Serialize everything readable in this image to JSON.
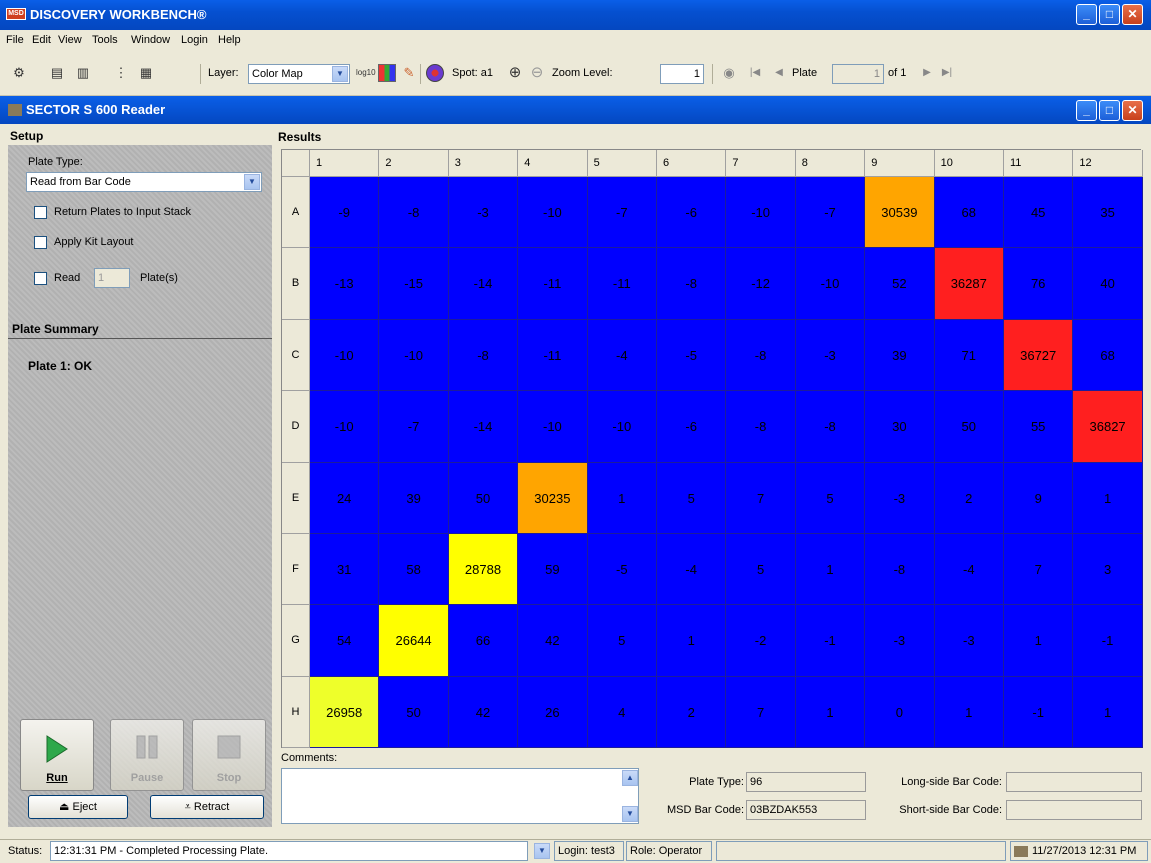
{
  "app": {
    "title": "DISCOVERY WORKBENCH®",
    "logo_text": "MSD"
  },
  "menu": [
    "File",
    "Edit",
    "View",
    "Tools",
    "Window",
    "Login",
    "Help"
  ],
  "toolbar": {
    "layer_label": "Layer:",
    "layer_value": "Color Map",
    "spot_label": "Spot: a1",
    "zoom_label": "Zoom Level:",
    "zoom_value": "1",
    "plate_label": "Plate",
    "plate_value": "1",
    "plate_of": "of 1",
    "log_label": "log10"
  },
  "inner_window": {
    "title": "SECTOR S 600 Reader"
  },
  "setup": {
    "header": "Setup",
    "plate_type_label": "Plate Type:",
    "plate_type_value": "Read from Bar Code",
    "return_plates": "Return Plates to Input Stack",
    "apply_kit": "Apply Kit Layout",
    "read_label": "Read",
    "read_value": "1",
    "plates_label": "Plate(s)",
    "summary_header": "Plate Summary",
    "summary_line": "Plate 1: OK",
    "run": "Run",
    "pause": "Pause",
    "stop": "Stop",
    "eject": "Eject",
    "retract": "Retract"
  },
  "results": {
    "header": "Results",
    "columns": [
      "1",
      "2",
      "3",
      "4",
      "5",
      "6",
      "7",
      "8",
      "9",
      "10",
      "11",
      "12"
    ],
    "rows": [
      {
        "label": "A",
        "values": [
          "-9",
          "-8",
          "-3",
          "-10",
          "-7",
          "-6",
          "-10",
          "-7",
          "30539",
          "68",
          "45",
          "35"
        ]
      },
      {
        "label": "B",
        "values": [
          "-13",
          "-15",
          "-14",
          "-11",
          "-11",
          "-8",
          "-12",
          "-10",
          "52",
          "36287",
          "76",
          "40"
        ]
      },
      {
        "label": "C",
        "values": [
          "-10",
          "-10",
          "-8",
          "-11",
          "-4",
          "-5",
          "-8",
          "-3",
          "39",
          "71",
          "36727",
          "68"
        ]
      },
      {
        "label": "D",
        "values": [
          "-10",
          "-7",
          "-14",
          "-10",
          "-10",
          "-6",
          "-8",
          "-8",
          "30",
          "50",
          "55",
          "36827"
        ]
      },
      {
        "label": "E",
        "values": [
          "24",
          "39",
          "50",
          "30235",
          "1",
          "5",
          "7",
          "5",
          "-3",
          "2",
          "9",
          "1"
        ]
      },
      {
        "label": "F",
        "values": [
          "31",
          "58",
          "28788",
          "59",
          "-5",
          "-4",
          "5",
          "1",
          "-8",
          "-4",
          "7",
          "3"
        ]
      },
      {
        "label": "G",
        "values": [
          "54",
          "26644",
          "66",
          "42",
          "5",
          "1",
          "-2",
          "-1",
          "-3",
          "-3",
          "1",
          "-1"
        ]
      },
      {
        "label": "H",
        "values": [
          "26958",
          "50",
          "42",
          "26",
          "4",
          "2",
          "7",
          "1",
          "0",
          "1",
          "-1",
          "1"
        ]
      }
    ],
    "colors": {
      "low": "#0000ff",
      "yellow": "#ffff00",
      "yellow_green": "#eeff2a",
      "orange": "#ffa500",
      "red": "#ff1f1f"
    }
  },
  "info": {
    "comments_label": "Comments:",
    "plate_type_label": "Plate Type:",
    "plate_type_value": "96",
    "msd_barcode_label": "MSD Bar Code:",
    "msd_barcode_value": "03BZDAK553",
    "long_side_label": "Long-side Bar Code:",
    "long_side_value": "",
    "short_side_label": "Short-side Bar Code:",
    "short_side_value": ""
  },
  "status": {
    "label": "Status:",
    "text": "12:31:31 PM - Completed Processing Plate.",
    "login": "Login: test3",
    "role": "Role: Operator",
    "datetime": "11/27/2013 12:31 PM"
  }
}
